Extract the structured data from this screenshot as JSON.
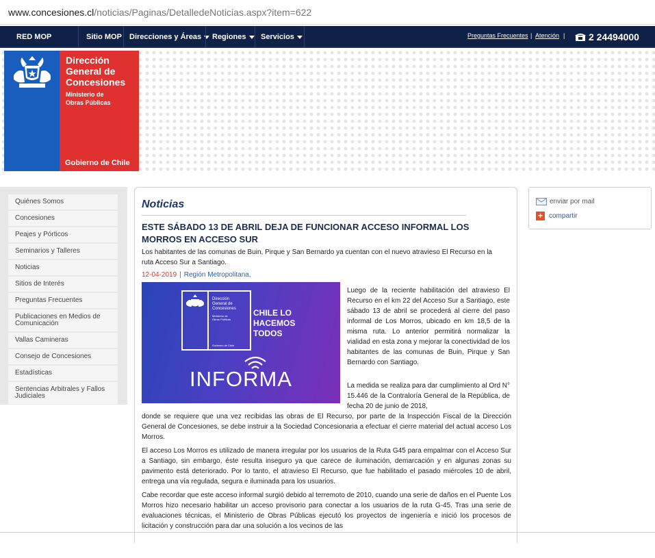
{
  "browser": {
    "url_host": "www.concesiones.cl",
    "url_path": "/noticias/Paginas/DetalledeNoticias.aspx?item=622"
  },
  "topnav": {
    "brand": "RED MOP",
    "items": [
      {
        "label": "Sitio MOP",
        "dropdown": false
      },
      {
        "label": "Direcciones y Áreas",
        "dropdown": true
      },
      {
        "label": "Regiones",
        "dropdown": true
      },
      {
        "label": "Servicios",
        "dropdown": true
      }
    ],
    "links": [
      "Preguntas Frecuentes",
      "Atención"
    ],
    "phone": "2 24494000"
  },
  "logo": {
    "title": [
      "Dirección",
      "General de",
      "Concesiones"
    ],
    "subtitle": [
      "Ministerio de",
      "Obras Públicas"
    ],
    "footer": "Gobierno de Chile"
  },
  "sidebar": {
    "items": [
      "Quiénes Somos",
      "Concesiones",
      "Peajes y Pórticos",
      "Seminarios y Talleres",
      "Noticias",
      "Sitios de Interés",
      "Preguntas Frecuentes",
      "Publicaciones en Medios de Comunicación",
      "Vallas Camineras",
      "Consejo de Concesiones",
      "Estadísticas",
      "Sentencias Arbitrales y Fallos Judiciales"
    ]
  },
  "article": {
    "section": "Noticias",
    "headline": "ESTE SÁBADO 13 DE ABRIL DEJA DE FUNCIONAR ACCESO INFORMAL LOS MORROS EN ACCESO SUR",
    "lead": "Los habitantes de las comunas de Buin, Pirque y San Bernardo ya cuentan con el nuevo atravieso El Recurso en la ruta Acceso Sur a Santiago.",
    "date": "12-04-2019",
    "region": "Región Metropolitana,",
    "image": {
      "org": [
        "Dirección",
        "General de",
        "Concesiones"
      ],
      "ministry": [
        "Ministerio de",
        "Obras Públicas"
      ],
      "gov": "Gobierno de Chile",
      "slogan": [
        "CHILE LO",
        "HACEMOS",
        "TODOS"
      ],
      "word": "INFORMA"
    },
    "p1": "Luego de la reciente habilitación del atravieso El Recurso en el km 22 del Acceso Sur a Santiago, este sábado 13 de abril se procederá al cierre del paso informal de Los Morros, ubicado en km 18,5 de la misma ruta. Lo anterior permitirá normalizar la vialidad en esta zona y mejorar la conectividad de los habitantes de las comunas de Buin, Pirque y San Bernardo con Santiago.",
    "p2_beside": "La medida se realiza para dar cumplimiento al Ord N° 15.446 de la Contraloría General de la República, de fecha 20 de junio de 2018,",
    "p2_full": "donde se requiere que una vez recibidas las obras de El Recurso, por parte de la Inspección Fiscal de la Dirección General de Concesiones, se debe instruir a la Sociedad Concesionaria a efectuar el cierre material del actual acceso Los Morros.",
    "p3": "El acceso Los Morros es utilizado de manera irregular por los usuarios de la Ruta G45 para empalmar con el Acceso Sur a Santiago, sin embargo, éste resulta inseguro ya que carece de iluminación, demarcación y en algunas zonas su pavimento está deteriorado. Por lo tanto, el atravieso El Recurso, que fue habilitado el pasado miércoles 10 de abril, entrega una vía regulada, segura e iluminada para los usuarios.",
    "p4": "Cabe recordar que este acceso informal surgió debido al terremoto de 2010, cuando una serie de daños en el Puente Los Morros hizo necesario habilitar un acceso provisorio para conectar a los usuarios de la ruta G-45. Tras una serie de evaluaciones técnicas, el Ministerio de Obras Públicas ejecutó los proyectos de ingeniería e inició los procesos de licitación y construcción para dar una solución a los vecinos de las"
  },
  "share": {
    "mail": "enviar por mail",
    "share": "compartir"
  },
  "colors": {
    "navy": "#0f2146",
    "blue": "#1a5ebd",
    "red": "#e03131",
    "title": "#1c3769"
  }
}
